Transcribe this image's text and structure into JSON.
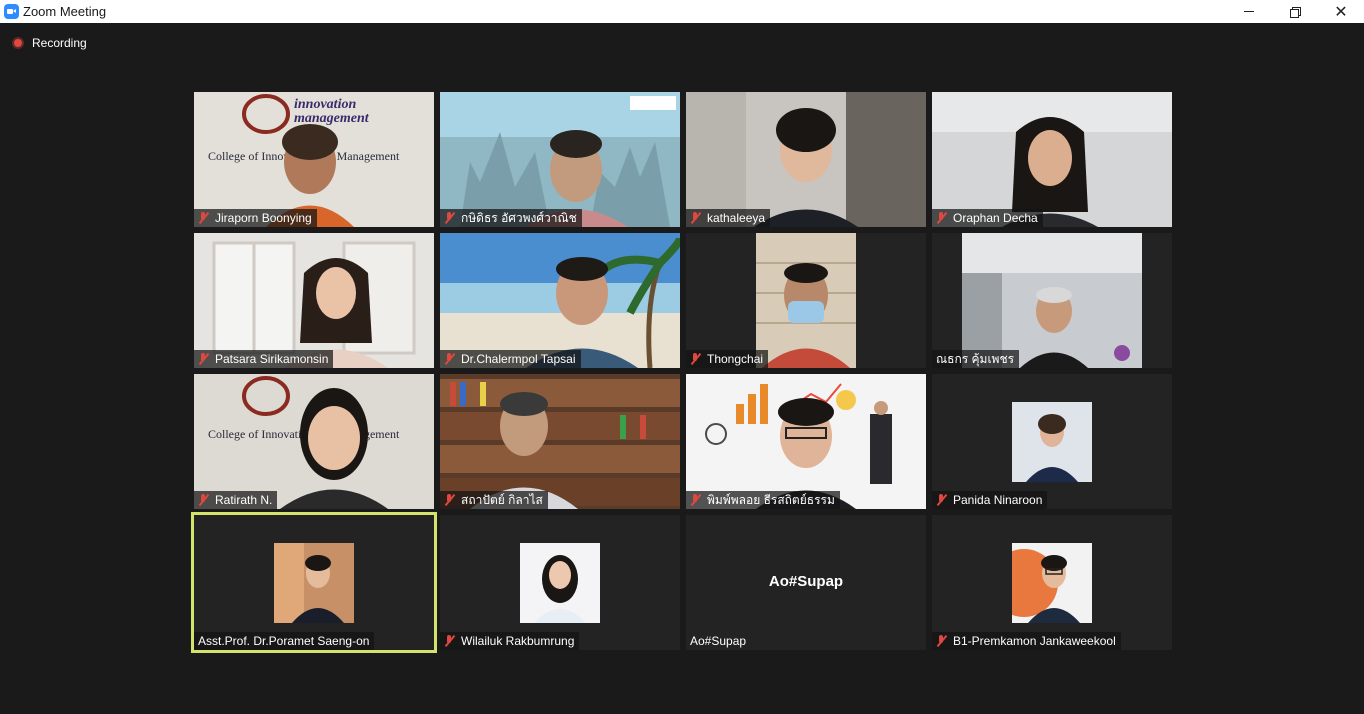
{
  "window": {
    "title": "Zoom Meeting",
    "icon": "zoom-camera-icon",
    "buttons": {
      "minimize": "minimize-icon",
      "maximize": "restore-icon",
      "close": "close-icon"
    }
  },
  "recording": {
    "label": "Recording",
    "color": "#e0483f"
  },
  "colors": {
    "active_speaker": "#d4e36b",
    "muted": "#e0483f",
    "background": "#1a1a1a"
  },
  "participants": [
    {
      "name": "Jiraporn Boonying",
      "muted": true
    },
    {
      "name": "กษิดิธร อัศวพงศ์วาณิช",
      "muted": true
    },
    {
      "name": "kathaleeya",
      "muted": true
    },
    {
      "name": "Oraphan Decha",
      "muted": true
    },
    {
      "name": "Patsara Sirikamonsin",
      "muted": true
    },
    {
      "name": "Dr.Chalermpol Tapsai",
      "muted": true
    },
    {
      "name": "Thongchai",
      "muted": true
    },
    {
      "name": "ณธกร คุ้มเพชร",
      "muted": false
    },
    {
      "name": "Ratirath N.",
      "muted": true
    },
    {
      "name": "สถาปัตย์ กิลาไส",
      "muted": true
    },
    {
      "name": "พิมพ์พลอย ธีรสถิตย์ธรรม",
      "muted": true
    },
    {
      "name": "Panida Ninaroon",
      "muted": true
    },
    {
      "name": "Asst.Prof. Dr.Poramet Saeng-on",
      "muted": false,
      "active_speaker": true
    },
    {
      "name": "Wilailuk Rakbumrung",
      "muted": true
    },
    {
      "name": "Ao#Supap",
      "muted": false,
      "no_video": true
    },
    {
      "name": "B1-Premkamon Jankaweekool",
      "muted": true
    }
  ],
  "logo_text": {
    "line1": "innovation",
    "line2": "management",
    "college": "College of Innovation and Management"
  }
}
